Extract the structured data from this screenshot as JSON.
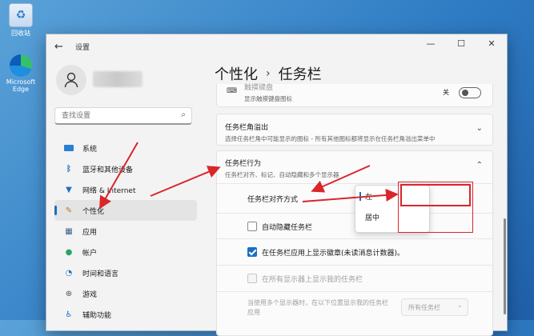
{
  "desktop": {
    "icons": [
      {
        "label": "回收站",
        "icon": "recycle-bin-icon"
      },
      {
        "label": "Microsoft Edge",
        "icon": "edge-icon"
      }
    ]
  },
  "window": {
    "title": "设置",
    "controls": {
      "minimize": "—",
      "maximize": "☐",
      "close": "✕"
    }
  },
  "sidebar": {
    "search_placeholder": "查找设置",
    "items": [
      {
        "label": "系统",
        "icon": "monitor-icon",
        "active": false
      },
      {
        "label": "蓝牙和其他设备",
        "icon": "bluetooth-icon",
        "active": false
      },
      {
        "label": "网络 & Internet",
        "icon": "wifi-icon",
        "active": false
      },
      {
        "label": "个性化",
        "icon": "brush-icon",
        "active": true
      },
      {
        "label": "应用",
        "icon": "apps-icon",
        "active": false
      },
      {
        "label": "帐户",
        "icon": "account-icon",
        "active": false
      },
      {
        "label": "时间和语言",
        "icon": "globe-clock-icon",
        "active": false
      },
      {
        "label": "游戏",
        "icon": "gamepad-icon",
        "active": false
      },
      {
        "label": "辅助功能",
        "icon": "accessibility-icon",
        "active": false
      }
    ]
  },
  "breadcrumb": {
    "parent": "个性化",
    "separator": "›",
    "current": "任务栏"
  },
  "content": {
    "partial_item": {
      "title": "触摸键盘",
      "desc": "显示触摸键盘图标",
      "toggle_label": "关"
    },
    "overflow": {
      "title": "任务栏角溢出",
      "desc": "选择任务栏角中可能显示的图标 - 所有其他图标都将显示在任务栏角溢出菜单中"
    },
    "behaviors": {
      "title": "任务栏行为",
      "desc": "任务栏对齐、标记、自动隐藏和多个显示器",
      "alignment_label": "任务栏对齐方式",
      "alignment_options": [
        "左",
        "居中"
      ],
      "alignment_selected": "左",
      "options": [
        {
          "label": "自动隐藏任务栏",
          "checked": false,
          "disabled": false
        },
        {
          "label": "在任务栏应用上显示徽章(未读消息计数器)。",
          "checked": true,
          "disabled": false
        },
        {
          "label": "在所有显示器上显示我的任务栏",
          "checked": false,
          "disabled": true
        }
      ],
      "multi_display_label": "当使用多个显示器时，在以下位置显示我的任务栏应用",
      "multi_display_value": "所有任务栏"
    }
  }
}
